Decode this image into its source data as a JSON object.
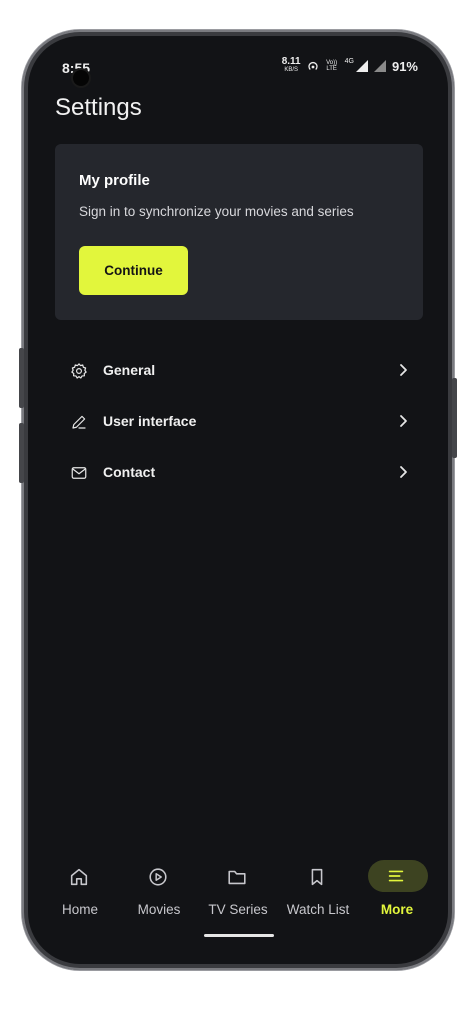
{
  "status_bar": {
    "time": "8:55",
    "net_speed_value": "8.11",
    "net_speed_unit": "KB/S",
    "hotspot_icon": "hotspot-icon",
    "volte_label": "Vo)) LTE",
    "network_label": "4G",
    "battery": "91%"
  },
  "page": {
    "title": "Settings"
  },
  "profile": {
    "title": "My profile",
    "subtitle": "Sign in to synchronize your movies and series",
    "button_label": "Continue"
  },
  "menu": {
    "items": [
      {
        "label": "General",
        "icon": "gear-icon"
      },
      {
        "label": "User interface",
        "icon": "pencil-icon"
      },
      {
        "label": "Contact",
        "icon": "mail-icon"
      }
    ]
  },
  "tabs": [
    {
      "label": "Home",
      "icon": "home-icon",
      "active": false
    },
    {
      "label": "Movies",
      "icon": "play-circle-icon",
      "active": false
    },
    {
      "label": "TV Series",
      "icon": "folder-icon",
      "active": false
    },
    {
      "label": "Watch List",
      "icon": "bookmark-icon",
      "active": false
    },
    {
      "label": "More",
      "icon": "menu-icon",
      "active": true
    }
  ],
  "colors": {
    "accent": "#e2f63c",
    "background": "#121316",
    "card": "#25272d",
    "active_pill": "#3d4321"
  }
}
